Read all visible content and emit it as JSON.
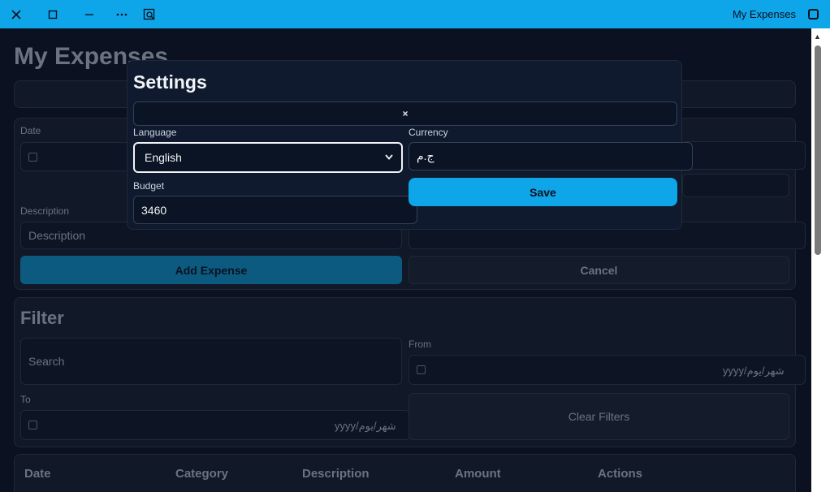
{
  "window": {
    "title": "My Expenses",
    "accent": "#0ea5e9"
  },
  "app": {
    "heading": "My Expenses",
    "form": {
      "date_label": "Date",
      "description_label": "Description",
      "description_placeholder": "Description",
      "add_button": "Add Expense",
      "cancel_button": "Cancel"
    },
    "filter": {
      "title": "Filter",
      "search_placeholder": "Search",
      "from_label": "From",
      "to_label": "To",
      "from_value": "yyyy/شهر/يوم",
      "to_value": "yyyy/شهر/يوم",
      "clear_button": "Clear Filters"
    },
    "table": {
      "headers": [
        "Date",
        "Category",
        "Description",
        "Amount",
        "Actions"
      ]
    }
  },
  "settings": {
    "title": "Settings",
    "close_icon": "×",
    "language_label": "Language",
    "language_value": "English",
    "currency_label": "Currency",
    "currency_value": "ج.م",
    "budget_label": "Budget",
    "budget_value": "3460",
    "save_button": "Save"
  }
}
